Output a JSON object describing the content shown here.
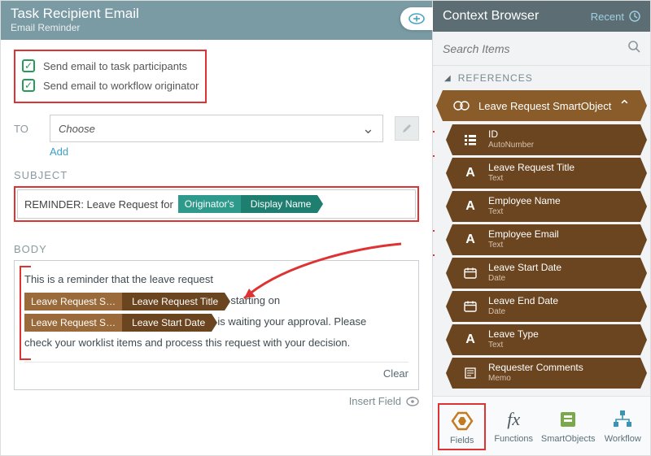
{
  "header": {
    "title": "Task Recipient Email",
    "subtitle": "Email Reminder"
  },
  "checks": {
    "participants": "Send email to task participants",
    "originator": "Send email to workflow originator"
  },
  "to": {
    "label": "TO",
    "placeholder": "Choose",
    "add": "Add"
  },
  "subject": {
    "label": "SUBJECT",
    "prefix": "REMINDER: Leave Request for",
    "tag_a": "Originator's",
    "tag_b": "Display Name"
  },
  "body": {
    "label": "BODY",
    "line1": "This is a reminder that the leave request",
    "tag1_a": "Leave Request S…",
    "tag1_b": "Leave Request Title",
    "mid1": "starting on",
    "tag2_a": "Leave Request S…",
    "tag2_b": "Leave Start Date",
    "mid2": "is waiting your approval. Please",
    "line3": "check your worklist items and process this request with your decision.",
    "clear": "Clear",
    "insert": "Insert Field"
  },
  "context": {
    "title": "Context Browser",
    "recent": "Recent",
    "search_placeholder": "Search Items",
    "refs_label": "REFERENCES",
    "group": "Leave Request SmartObject",
    "items": [
      {
        "icon": "list",
        "title": "ID",
        "sub": "AutoNumber"
      },
      {
        "icon": "A",
        "title": "Leave Request Title",
        "sub": "Text"
      },
      {
        "icon": "A",
        "title": "Employee Name",
        "sub": "Text"
      },
      {
        "icon": "A",
        "title": "Employee Email",
        "sub": "Text"
      },
      {
        "icon": "cal",
        "title": "Leave Start Date",
        "sub": "Date"
      },
      {
        "icon": "cal",
        "title": "Leave End Date",
        "sub": "Date"
      },
      {
        "icon": "A",
        "title": "Leave Type",
        "sub": "Text"
      },
      {
        "icon": "memo",
        "title": "Requester Comments",
        "sub": "Memo"
      }
    ],
    "tabs": {
      "fields": "Fields",
      "functions": "Functions",
      "smartobjects": "SmartObjects",
      "workflow": "Workflow"
    }
  }
}
